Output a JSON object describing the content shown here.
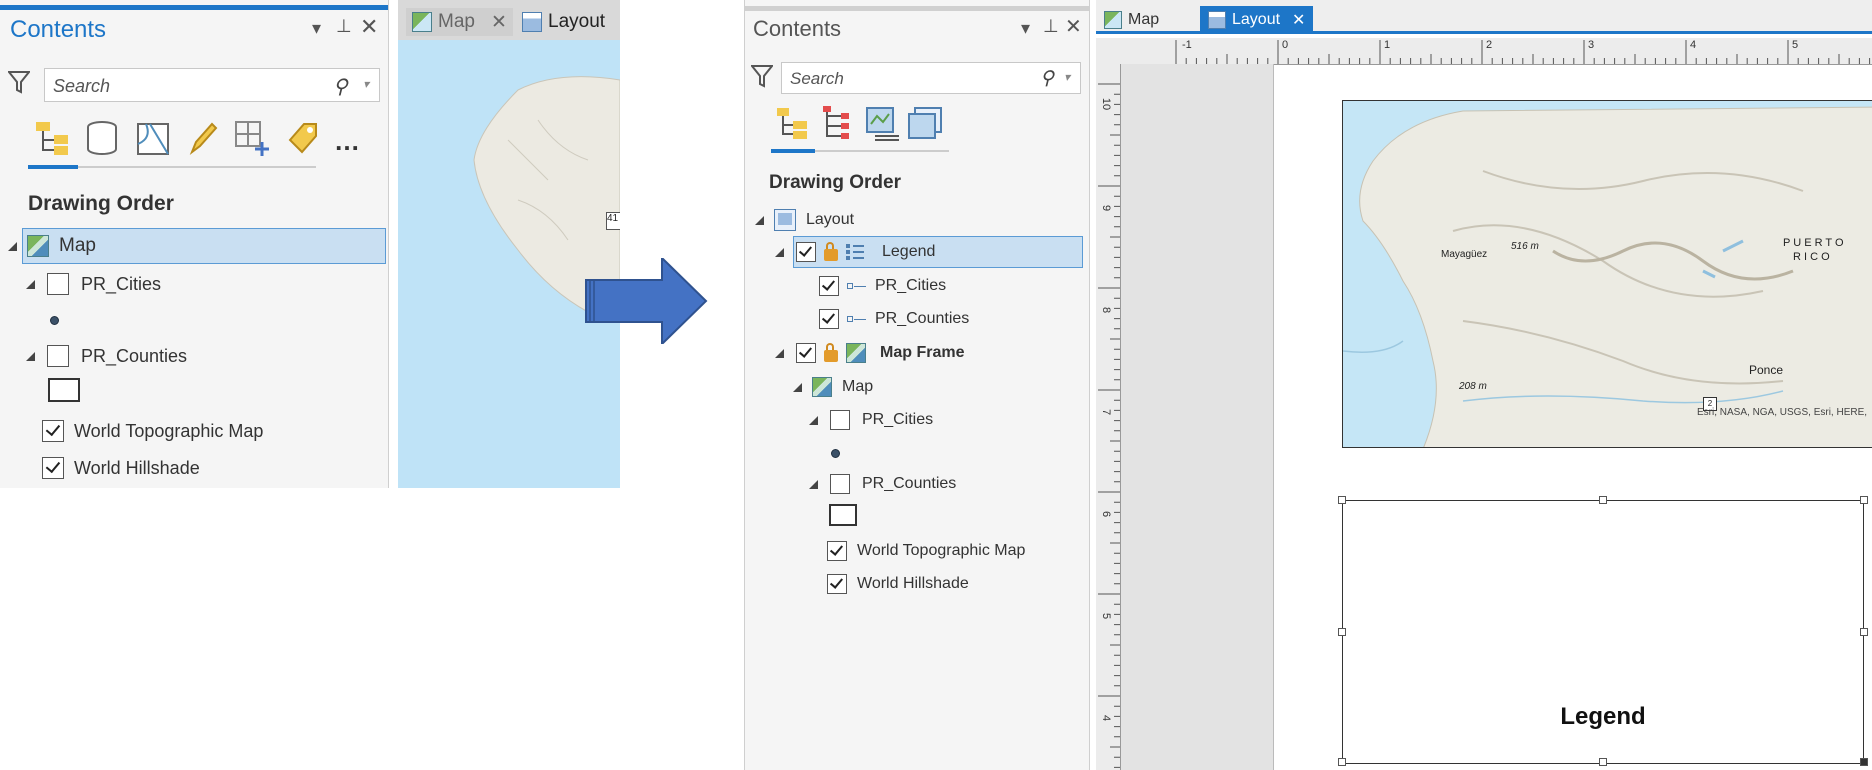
{
  "left": {
    "contents_title": "Contents",
    "search_placeholder": "Search",
    "drawing_order_heading": "Drawing Order",
    "tabs": [
      "Map",
      "Layout"
    ],
    "layers": [
      {
        "label": "Map",
        "checked": null,
        "selected": true
      },
      {
        "label": "PR_Cities",
        "checked": false
      },
      {
        "label": "PR_Counties",
        "checked": false
      },
      {
        "label": "World Topographic Map",
        "checked": true
      },
      {
        "label": "World Hillshade",
        "checked": true
      }
    ],
    "map_label_fragment": "41"
  },
  "right": {
    "contents_title": "Contents",
    "search_placeholder": "Search",
    "drawing_order_heading": "Drawing Order",
    "tabs": [
      "Map",
      "Layout"
    ],
    "tree": {
      "layout": "Layout",
      "legend": "Legend",
      "legend_items": [
        "PR_Cities",
        "PR_Counties"
      ],
      "map_frame": "Map Frame",
      "map": "Map",
      "layers": [
        {
          "label": "PR_Cities",
          "checked": false
        },
        {
          "label": "PR_Counties",
          "checked": false
        },
        {
          "label": "World Topographic Map",
          "checked": true
        },
        {
          "label": "World Hillshade",
          "checked": true
        }
      ]
    },
    "ruler_h_labels": [
      "-1",
      "0",
      "1",
      "2",
      "3",
      "4",
      "5"
    ],
    "ruler_v_labels": [
      "10",
      "9",
      "8",
      "7",
      "6",
      "5",
      "4"
    ],
    "map_labels": {
      "mayaguez": "Mayagüez",
      "elev1": "516 m",
      "elev2": "208 m",
      "ponce": "Ponce",
      "route": "2",
      "puerto": "P U E R T O",
      "rico": "R I C O",
      "attribution": "Esri, NASA, NGA, USGS, Esri, HERE,"
    },
    "legend_title": "Legend"
  },
  "colors": {
    "accent": "#1d76c8",
    "arrow": "#4472c4",
    "selection": "#c9dff2",
    "water": "#bfe3f7"
  }
}
